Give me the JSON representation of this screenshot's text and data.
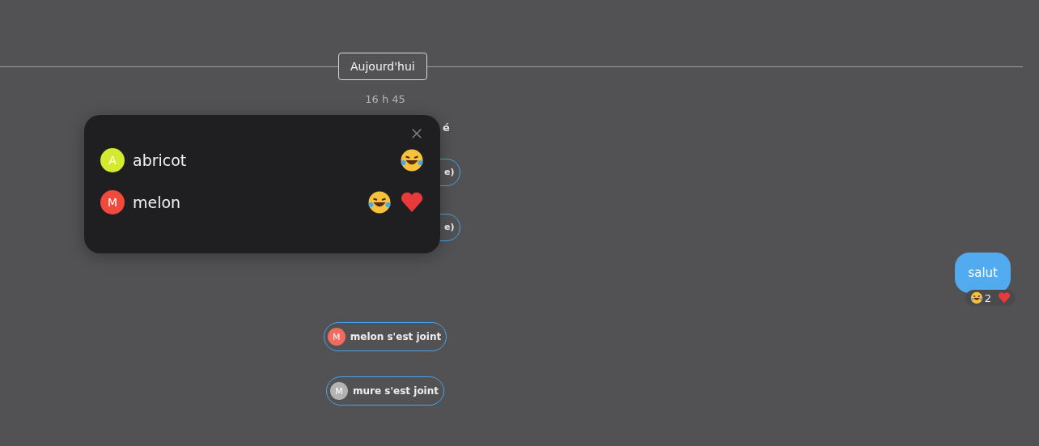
{
  "date_divider": "Aujourd'hui",
  "time": "16 h 45",
  "events": [
    {
      "kind": "bold_text",
      "text": "é"
    },
    {
      "kind": "pill",
      "text": "e)"
    },
    {
      "kind": "pill",
      "text": "e)"
    },
    {
      "kind": "message",
      "text": "salut",
      "reactions": [
        {
          "kind": "laugh",
          "count": "2"
        },
        {
          "kind": "heart"
        }
      ]
    },
    {
      "kind": "join",
      "initial": "M",
      "text": "melon s'est joint",
      "color": "#f26b5e"
    },
    {
      "kind": "join",
      "initial": "M",
      "text": "mure s'est joint",
      "color": "#b3b3b3"
    }
  ],
  "reactions_popup": {
    "users": [
      {
        "initial": "A",
        "name": "abricot",
        "color": "#d4ea2e",
        "reactions": [
          {
            "kind": "laugh"
          }
        ]
      },
      {
        "initial": "M",
        "name": "melon",
        "color": "#f04a3c",
        "reactions": [
          {
            "kind": "laugh"
          },
          {
            "kind": "heart"
          }
        ]
      }
    ]
  }
}
